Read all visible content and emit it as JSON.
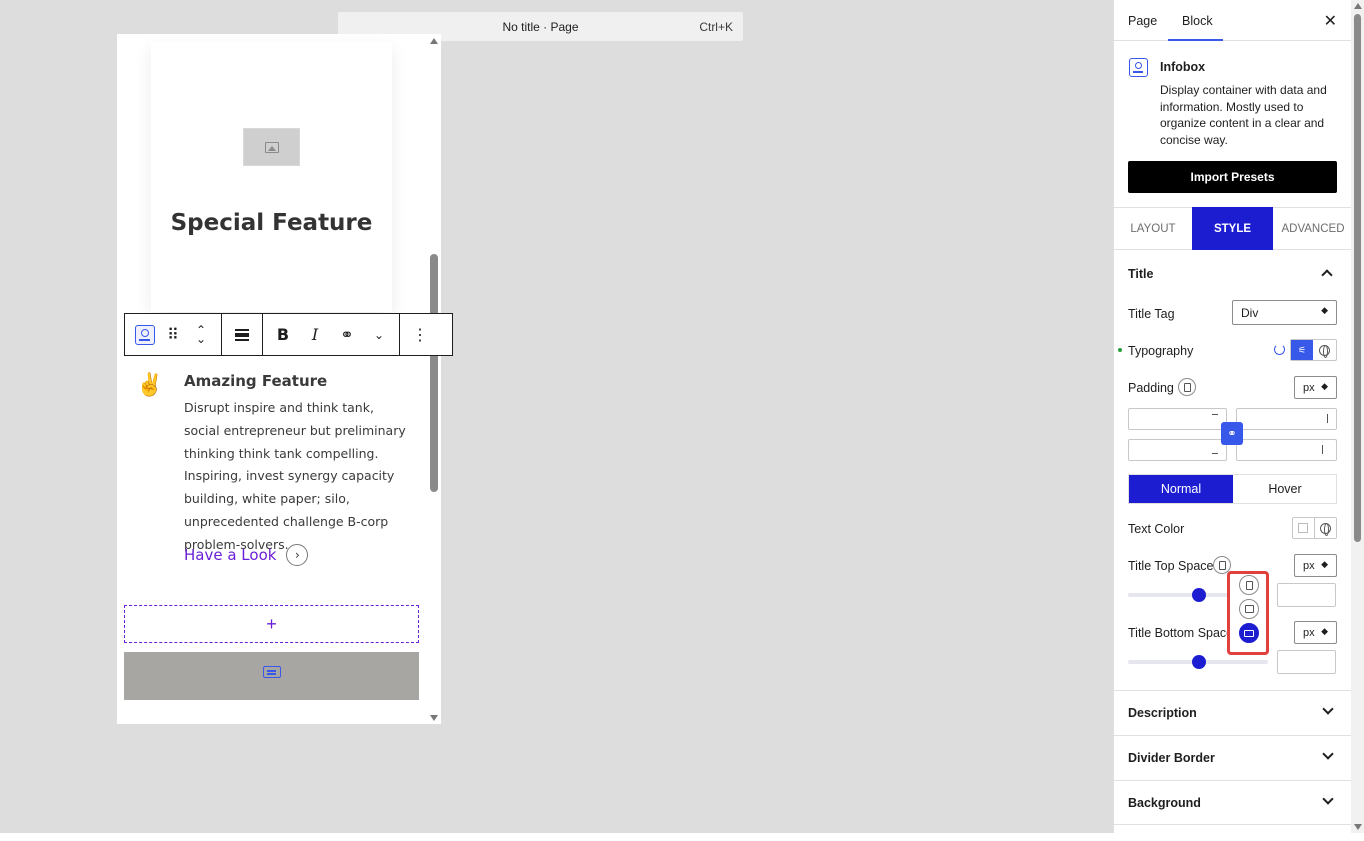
{
  "command_bar": {
    "title": "No title · Page",
    "shortcut": "Ctrl+K"
  },
  "canvas": {
    "card_heading": "Special Feature",
    "feature_title": "Amazing Feature",
    "feature_description": "Disrupt inspire and think tank, social entrepreneur but preliminary thinking think tank compelling. Inspiring, invest synergy capacity building, white paper; silo, unprecedented challenge B-corp problem-solvers.",
    "feature_link": "Have a Look",
    "appender_symbol": "+"
  },
  "block_toolbar": {
    "bold_label": "B",
    "italic_label": "I"
  },
  "sidebar": {
    "tabs": [
      "Page",
      "Block"
    ],
    "block_name": "Infobox",
    "block_description": "Display container with data and information. Mostly used to organize content in a clear and concise way.",
    "import_label": "Import Presets",
    "style_tabs": [
      "LAYOUT",
      "STYLE",
      "ADVANCED"
    ],
    "title_section": {
      "heading": "Title",
      "title_tag_label": "Title Tag",
      "title_tag_value": "Div",
      "typography_label": "Typography",
      "padding_label": "Padding",
      "padding_unit": "px",
      "state_normal": "Normal",
      "state_hover": "Hover",
      "text_color_label": "Text Color",
      "top_space_label": "Title Top Space",
      "top_space_unit": "px",
      "top_space_value": "",
      "bottom_space_label": "Title Bottom Space",
      "bottom_space_unit": "px",
      "bottom_space_value": ""
    },
    "collapsed_sections": [
      "Description",
      "Divider Border",
      "Background"
    ]
  },
  "colors": {
    "accent": "#1c1dd1",
    "link": "#6b1fd6",
    "highlight": "#e0413f"
  }
}
